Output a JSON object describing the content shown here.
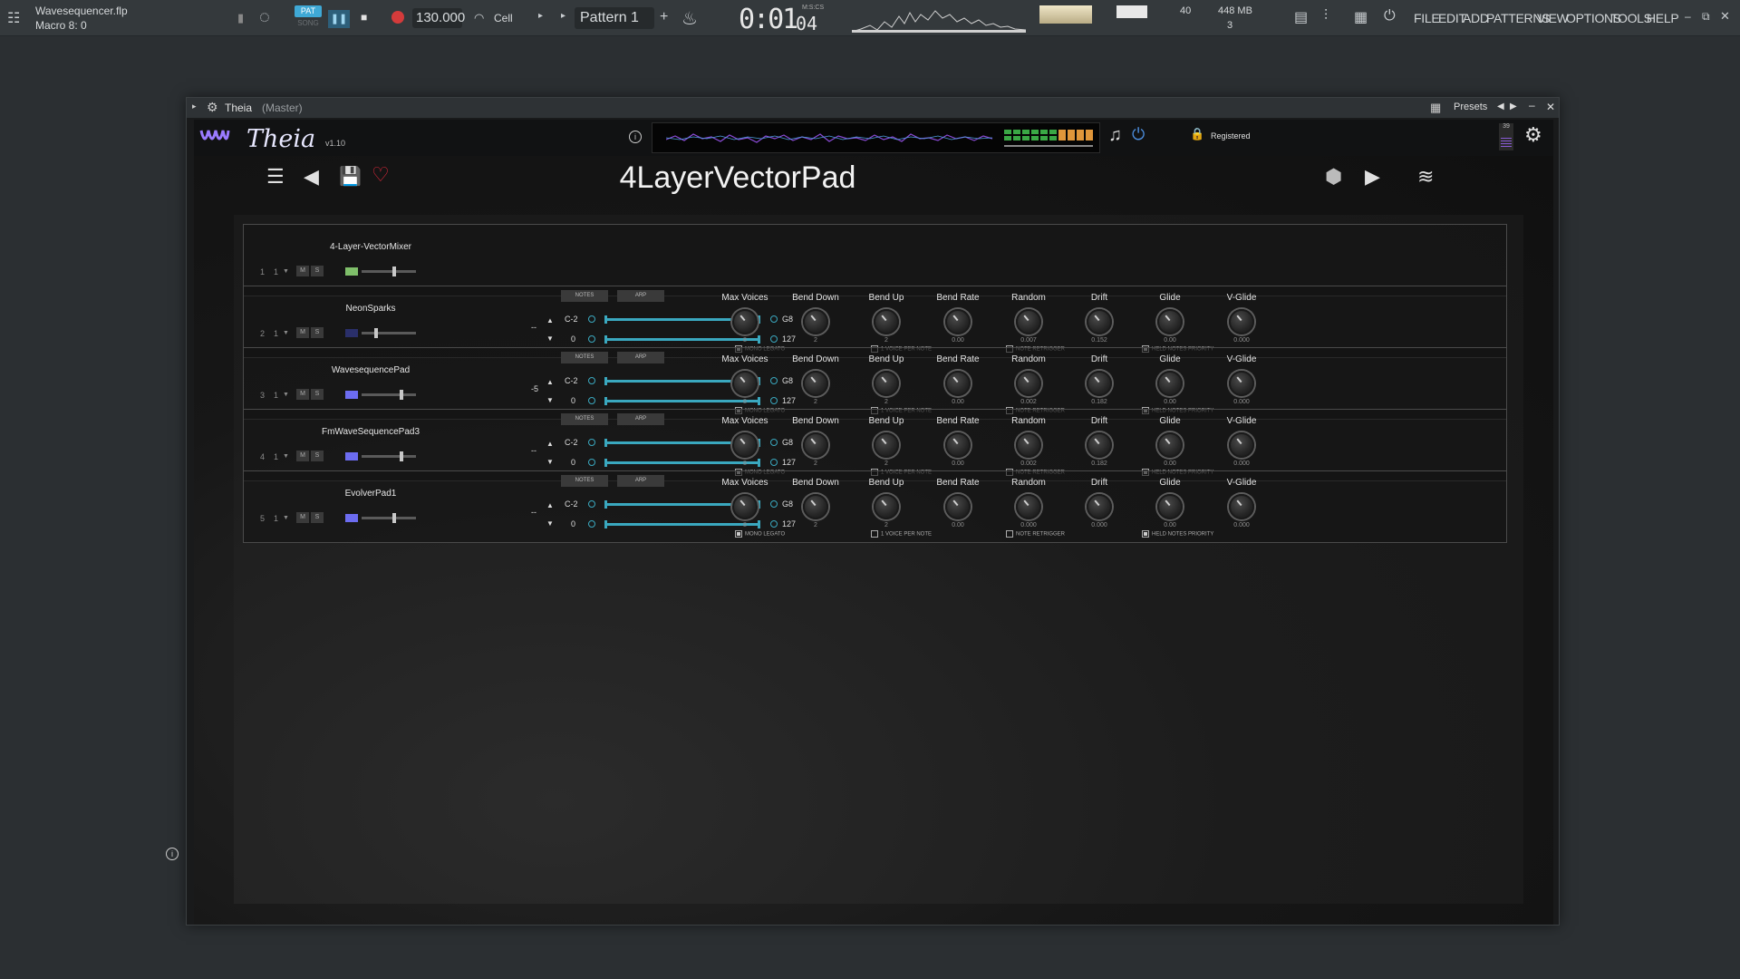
{
  "fl": {
    "project": "Wavesequencer.flp",
    "macro": "Macro 8: 0",
    "pat": "PAT",
    "song": "SONG",
    "tempo": "130.000",
    "snap": "Cell",
    "pattern": "Pattern 1",
    "time": "0:01",
    "time_ms": "04",
    "time_unit": "M:S:CS",
    "cpu": "40",
    "mem": "448 MB",
    "voices": "3",
    "menu": [
      "FILE",
      "EDIT",
      "ADD",
      "PATTERNS",
      "VIEW",
      "OPTIONS",
      "TOOLS",
      "HELP"
    ]
  },
  "window": {
    "title": "Theia",
    "title_suffix": "(Master)",
    "presets": "Presets"
  },
  "plugin": {
    "logo_text": "Theia",
    "version": "v1.10",
    "registered": "Registered",
    "preset_name": "4LayerVectorPad",
    "level_number": "39"
  },
  "layers": [
    {
      "num": "1",
      "chan": "1",
      "name": "4-Layer-VectorMixer",
      "swatch": "#7fbf6a",
      "vol": 0.6,
      "simple": true
    },
    {
      "num": "2",
      "chan": "1",
      "name": "NeonSparks",
      "swatch": "#2a2f6a",
      "vol": 0.25,
      "transpose": "--",
      "note_low": "C-2",
      "note_high": "G8",
      "vel_low": "0",
      "vel_high": "127",
      "values": [
        "8",
        "2",
        "2",
        "0.00",
        "0.007",
        "0.152",
        "0.00",
        "0.000"
      ]
    },
    {
      "num": "3",
      "chan": "1",
      "name": "WavesequencePad",
      "swatch": "#6c6cf0",
      "vol": 0.75,
      "transpose": "-5",
      "note_low": "C-2",
      "note_high": "G8",
      "vel_low": "0",
      "vel_high": "127",
      "values": [
        "8",
        "2",
        "2",
        "0.00",
        "0.002",
        "0.182",
        "0.00",
        "0.000"
      ]
    },
    {
      "num": "4",
      "chan": "1",
      "name": "FmWaveSequencePad3",
      "swatch": "#6c6cf0",
      "vol": 0.75,
      "transpose": "--",
      "note_low": "C-2",
      "note_high": "G8",
      "vel_low": "0",
      "vel_high": "127",
      "values": [
        "8",
        "2",
        "2",
        "0.00",
        "0.002",
        "0.182",
        "0.00",
        "0.000"
      ]
    },
    {
      "num": "5",
      "chan": "1",
      "name": "EvolverPad1",
      "swatch": "#6c6cf0",
      "vol": 0.6,
      "transpose": "--",
      "note_low": "C-2",
      "note_high": "G8",
      "vel_low": "0",
      "vel_high": "127",
      "values": [
        "8",
        "2",
        "2",
        "0.00",
        "0.000",
        "0.000",
        "0.00",
        "0.000"
      ]
    }
  ],
  "param_labels": [
    "Max Voices",
    "Bend Down",
    "Bend Up",
    "Bend Rate",
    "Random",
    "Drift",
    "Glide",
    "V-Glide"
  ],
  "buttons": {
    "notes": "NOTES",
    "arp": "ARP"
  },
  "checkboxes": [
    "MONO LEGATO",
    "1 VOICE PER NOTE",
    "NOTE RETRIGGER",
    "HELD NOTES PRIORITY"
  ],
  "checkbox_state": [
    true,
    false,
    false,
    true
  ]
}
